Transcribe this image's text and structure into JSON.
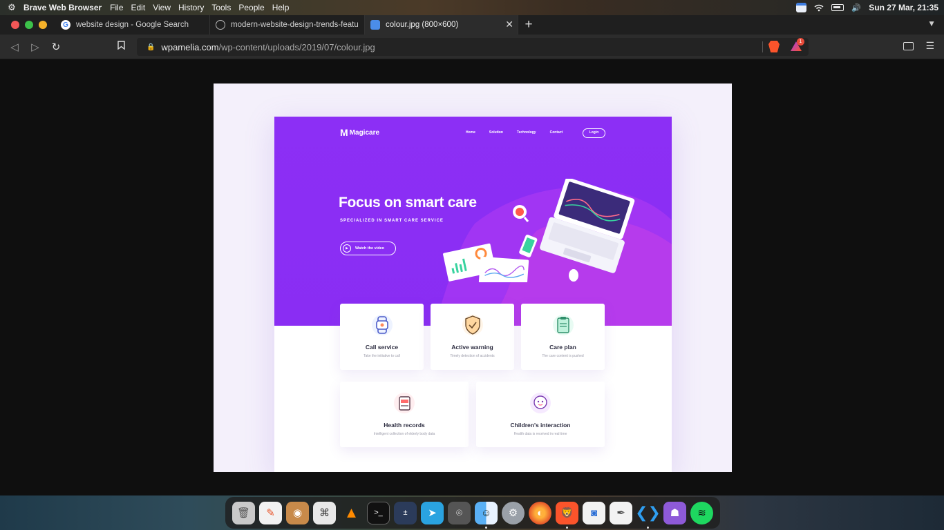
{
  "menubar": {
    "app_name": "Brave Web Browser",
    "menus": [
      "File",
      "Edit",
      "View",
      "History",
      "Tools",
      "People",
      "Help"
    ],
    "clock": "Sun 27 Mar, 21:35"
  },
  "tabs": [
    {
      "title": "website design - Google Search",
      "favicon": "google-icon"
    },
    {
      "title": "modern-website-design-trends-featu",
      "favicon": "globe-icon"
    },
    {
      "title": "colour.jpg (800×600)",
      "favicon": "shield-icon"
    }
  ],
  "address": {
    "host": "wpamelia.com",
    "path": "/wp-content/uploads/2019/07/colour.jpg",
    "rewards_badge": "1"
  },
  "mock": {
    "logo": "Magicare",
    "nav": [
      "Home",
      "Solution",
      "Technology",
      "Contact"
    ],
    "login": "Login",
    "title": "Focus on smart care",
    "subtitle": "SPECIALIZED IN SMART CARE SERVICE",
    "video": "Watch the video",
    "cards": [
      {
        "title": "Call service",
        "desc": "Take the initiative to call"
      },
      {
        "title": "Active warning",
        "desc": "Timely detection of accidents"
      },
      {
        "title": "Care plan",
        "desc": "The care content is pushed"
      },
      {
        "title": "Health records",
        "desc": "Intelligent collection of elderly body data"
      },
      {
        "title": "Children's interaction",
        "desc": "Health data is received in real time"
      }
    ]
  },
  "dock": [
    "trash-icon",
    "notes-icon",
    "gimp-icon",
    "keyboard-shortcuts-icon",
    "vlc-icon",
    "terminal-icon",
    "calculator-icon",
    "telegram-icon",
    "screenshot-icon",
    "finder-icon",
    "settings-icon",
    "firefox-icon",
    "brave-icon",
    "camera-icon",
    "text-editor-icon",
    "vscode-icon",
    "github-icon",
    "spotify-icon"
  ],
  "colors": {
    "hero_purple": "#8c2ff5",
    "brave_orange": "#fb542b"
  }
}
